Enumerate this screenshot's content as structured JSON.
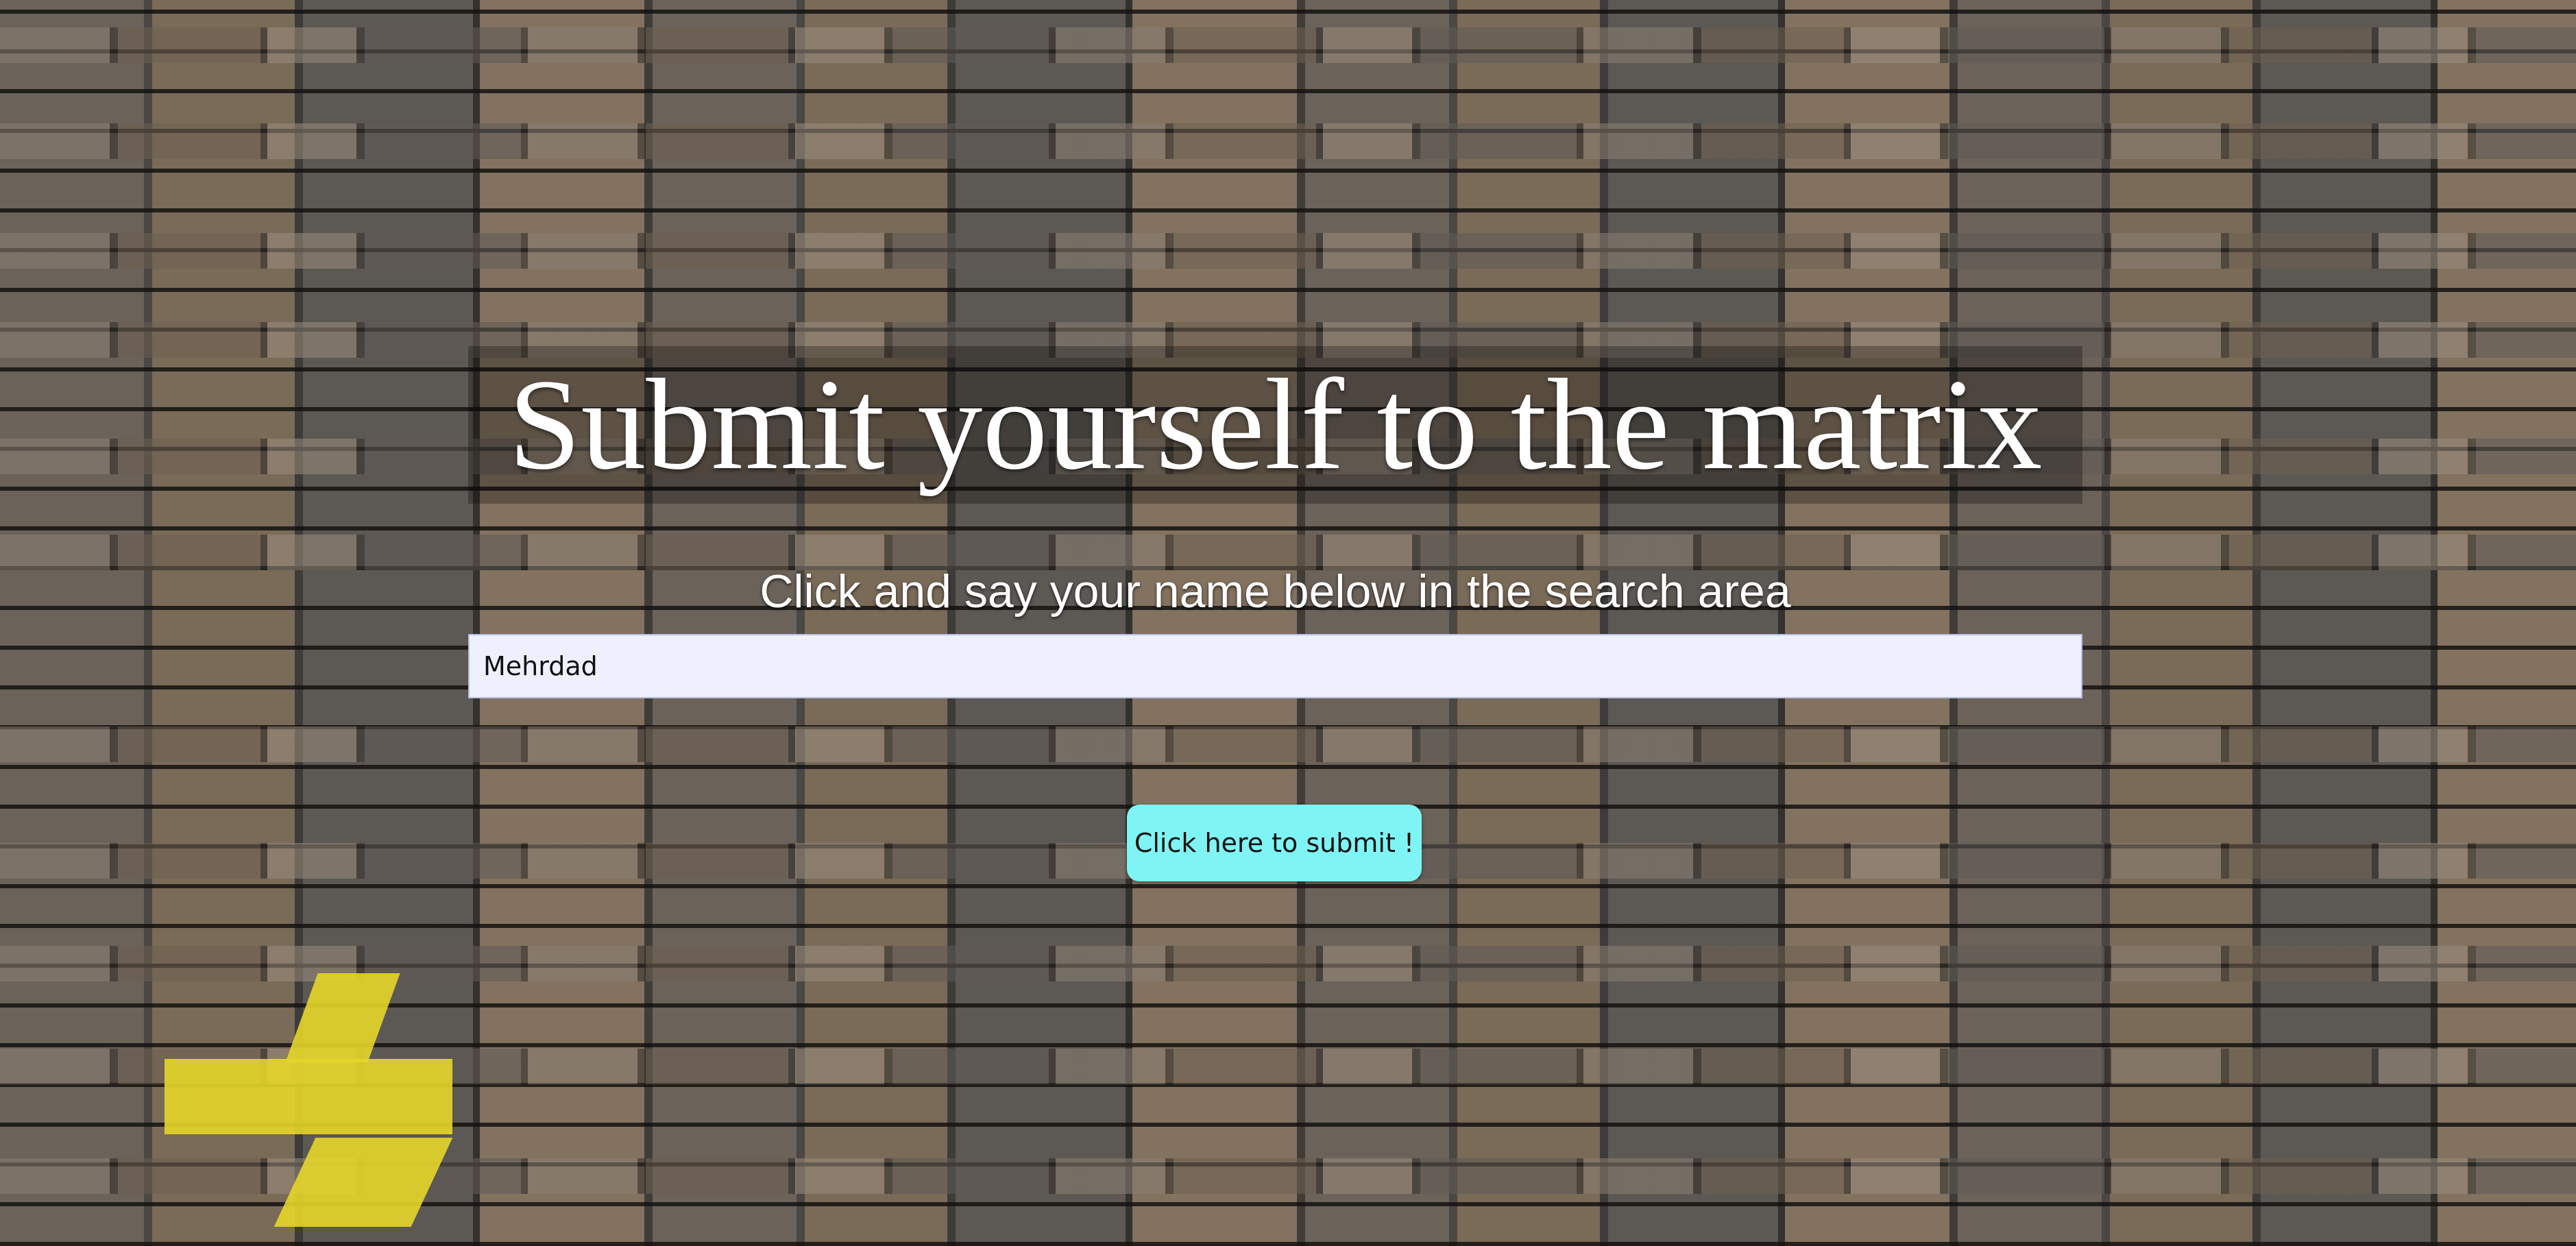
{
  "page": {
    "title": "Submit yourself to the matrix",
    "instruction": "Click and say your name below in the search area"
  },
  "search": {
    "value": "Mehrdad",
    "placeholder": ""
  },
  "submit": {
    "label": "Click here to submit !"
  },
  "colors": {
    "input_background": "#eef0ff",
    "button_background": "#7ff4f4",
    "title_text": "#ffffff"
  }
}
